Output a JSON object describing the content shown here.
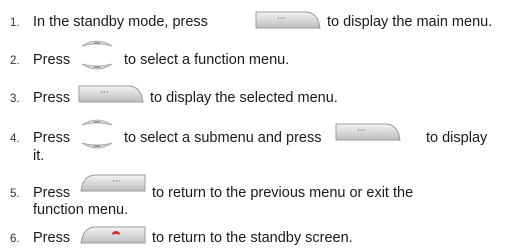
{
  "steps": [
    {
      "num": "1.",
      "before": "In the standby mode, press",
      "icon": "soft-key-left-icon",
      "after": "to display the main menu."
    },
    {
      "num": "2.",
      "before": "Press",
      "icon": "navigation-key-icon",
      "after": "to select a function menu."
    },
    {
      "num": "3.",
      "before": "Press",
      "icon": "soft-key-left-icon",
      "after": "to display the selected menu."
    },
    {
      "num": "4.",
      "before": "Press",
      "icon": "navigation-key-icon",
      "after": "to select a submenu and press",
      "icon2": "soft-key-left-icon",
      "after2": "to display",
      "cont": "it."
    },
    {
      "num": "5.",
      "before": "Press",
      "icon": "soft-key-right-icon",
      "after": "to return to the previous menu or exit the",
      "cont": "function menu."
    },
    {
      "num": "6.",
      "before": "Press",
      "icon": "end-call-key-icon",
      "after": "to return to the standby screen."
    }
  ]
}
